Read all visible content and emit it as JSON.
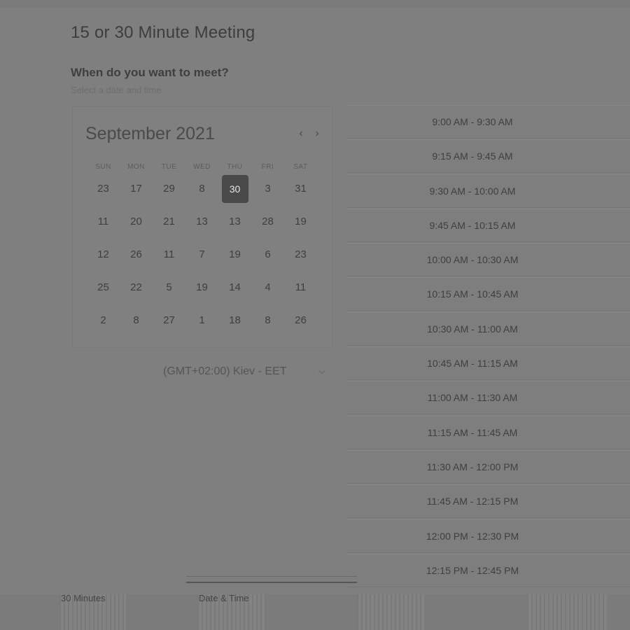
{
  "header": {
    "title": "15 or 30 Minute Meeting",
    "question": "When do you want to meet?",
    "hint": "Select a date and time"
  },
  "calendar": {
    "month_label": "September 2021",
    "prev_icon": "chevron-left-icon",
    "next_icon": "chevron-right-icon",
    "weekdays": [
      "SUN",
      "MON",
      "TUE",
      "WED",
      "THU",
      "FRI",
      "SAT"
    ],
    "days": [
      [
        "23",
        "17",
        "29",
        "8",
        "30",
        "3",
        "31"
      ],
      [
        "11",
        "20",
        "21",
        "13",
        "13",
        "28",
        "19"
      ],
      [
        "12",
        "26",
        "11",
        "7",
        "19",
        "6",
        "23"
      ],
      [
        "25",
        "22",
        "5",
        "19",
        "14",
        "4",
        "11"
      ],
      [
        "2",
        "8",
        "27",
        "1",
        "18",
        "8",
        "26"
      ]
    ],
    "selected_day": "30"
  },
  "timezone": {
    "label": "(GMT+02:00) Kiev - EET",
    "icon": "chevron-down-icon"
  },
  "time_slots": [
    "9:00 AM - 9:30 AM",
    "9:15 AM - 9:45 AM",
    "9:30 AM - 10:00 AM",
    "9:45 AM - 10:15 AM",
    "10:00 AM - 10:30 AM",
    "10:15 AM - 10:45 AM",
    "10:30 AM - 11:00 AM",
    "10:45 AM - 11:15 AM",
    "11:00 AM - 11:30 AM",
    "11:15 AM - 11:45 AM",
    "11:30 AM - 12:00 PM",
    "11:45 AM - 12:15 PM",
    "12:00 PM - 12:30 PM",
    "12:15 PM - 12:45 PM"
  ],
  "steps": [
    {
      "label": "30 Minutes"
    },
    {
      "label": "Date & Time"
    },
    {
      "label": ""
    },
    {
      "label": ""
    }
  ]
}
